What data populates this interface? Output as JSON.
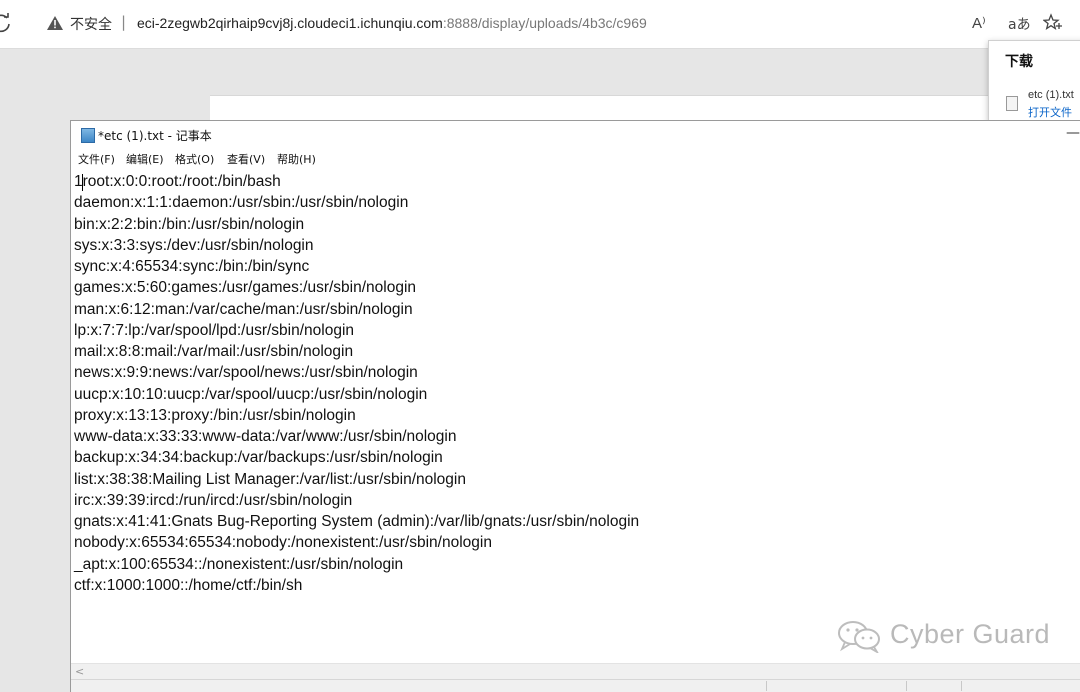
{
  "browser": {
    "security_label": "不安全",
    "separator": "|",
    "url_host": "eci-2zegwb2qirhaip9cvj8j.cloudeci1.ichunqiu.com",
    "url_rest": ":8888/display/uploads/4b3c/c969",
    "read_aloud_label": "A⁾",
    "translate_label": "aあ"
  },
  "downloads": {
    "title": "下载",
    "filename": "etc (1).txt",
    "open_file_label": "打开文件"
  },
  "notepad": {
    "title": "*etc (1).txt - 记事本",
    "minimize_label": "—",
    "menu": [
      {
        "label": "文件(F)"
      },
      {
        "label": "编辑(E)"
      },
      {
        "label": "格式(O)"
      },
      {
        "label": "查看(V)"
      },
      {
        "label": "帮助(H)"
      }
    ],
    "lines": [
      "1root:x:0:0:root:/root:/bin/bash",
      "daemon:x:1:1:daemon:/usr/sbin:/usr/sbin/nologin",
      "bin:x:2:2:bin:/bin:/usr/sbin/nologin",
      "sys:x:3:3:sys:/dev:/usr/sbin/nologin",
      "sync:x:4:65534:sync:/bin:/bin/sync",
      "games:x:5:60:games:/usr/games:/usr/sbin/nologin",
      "man:x:6:12:man:/var/cache/man:/usr/sbin/nologin",
      "lp:x:7:7:lp:/var/spool/lpd:/usr/sbin/nologin",
      "mail:x:8:8:mail:/var/mail:/usr/sbin/nologin",
      "news:x:9:9:news:/var/spool/news:/usr/sbin/nologin",
      "uucp:x:10:10:uucp:/var/spool/uucp:/usr/sbin/nologin",
      "proxy:x:13:13:proxy:/bin:/usr/sbin/nologin",
      "www-data:x:33:33:www-data:/var/www:/usr/sbin/nologin",
      "backup:x:34:34:backup:/var/backups:/usr/sbin/nologin",
      "list:x:38:38:Mailing List Manager:/var/list:/usr/sbin/nologin",
      "irc:x:39:39:ircd:/run/ircd:/usr/sbin/nologin",
      "gnats:x:41:41:Gnats Bug-Reporting System (admin):/var/lib/gnats:/usr/sbin/nologin",
      "nobody:x:65534:65534:nobody:/nonexistent:/usr/sbin/nologin",
      "_apt:x:100:65534::/nonexistent:/usr/sbin/nologin",
      "ctf:x:1000:1000::/home/ctf:/bin/sh"
    ],
    "scroll_left_label": "<"
  },
  "watermark": {
    "text": "Cyber Guard"
  },
  "colors": {
    "link": "#0a64c8",
    "warning": "#333333",
    "watermark": "#b9b9b9"
  }
}
